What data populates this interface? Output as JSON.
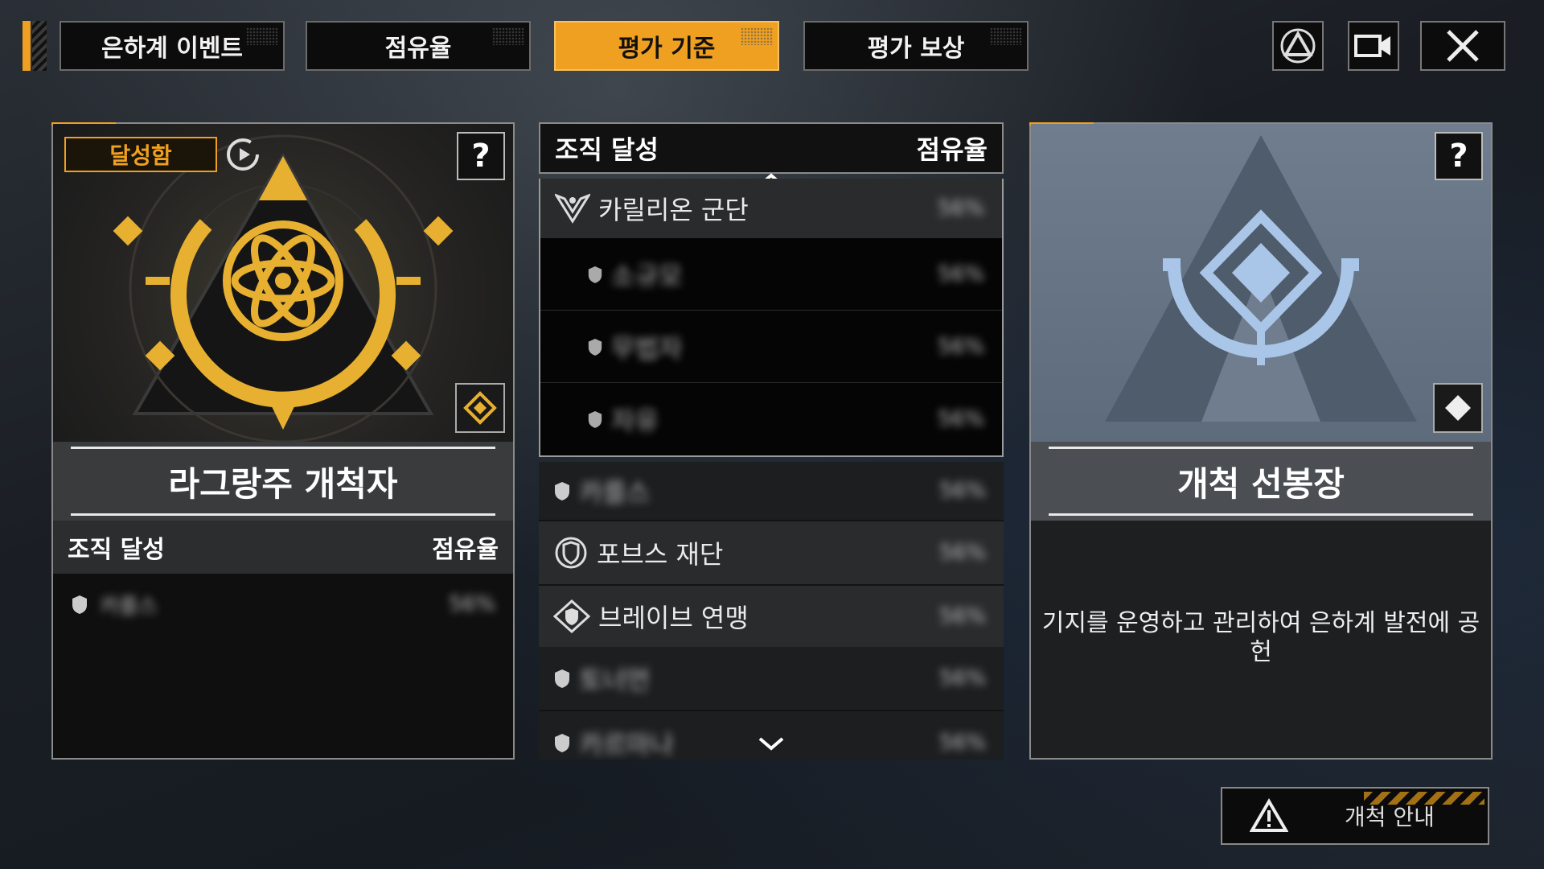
{
  "tabs": [
    {
      "label": "은하계 이벤트",
      "active": false
    },
    {
      "label": "점유율",
      "active": false
    },
    {
      "label": "평가 기준",
      "active": true
    },
    {
      "label": "평가 보상",
      "active": false
    }
  ],
  "top_icons": [
    "alliance-triangle-icon",
    "video-camera-icon",
    "close-icon"
  ],
  "left_card": {
    "status_badge": "달성함",
    "help": "?",
    "title": "라그랑주 개척자",
    "list_header": {
      "left": "조직 달성",
      "right": "점유율"
    },
    "rows": [
      {
        "name": "카를스",
        "pct": "56%"
      }
    ]
  },
  "middle_list": {
    "header": {
      "left": "조직 달성",
      "right": "점유율"
    },
    "groups": [
      {
        "name": "카릴리온 군단",
        "pct": "56%",
        "children": [
          {
            "name": "소규모",
            "pct": "56%"
          },
          {
            "name": "무법자",
            "pct": "56%"
          },
          {
            "name": "자유",
            "pct": "56%"
          }
        ]
      },
      {
        "name": "카를스",
        "pct": "56%",
        "type": "item"
      },
      {
        "name": "포브스 재단",
        "pct": "56%",
        "type": "parent"
      },
      {
        "name": "브레이브 연맹",
        "pct": "56%",
        "type": "parent"
      },
      {
        "name": "토너먼",
        "pct": "56%",
        "type": "item"
      },
      {
        "name": "카르마나",
        "pct": "56%",
        "type": "item"
      }
    ]
  },
  "right_card": {
    "help": "?",
    "title": "개척 선봉장",
    "description": "기지를 운영하고 관리하여 은하계 발전에 공헌"
  },
  "guide_button": {
    "label": "개척 안내"
  },
  "colors": {
    "accent": "#f0a020",
    "emblem_blue": "#a9c6e8"
  }
}
